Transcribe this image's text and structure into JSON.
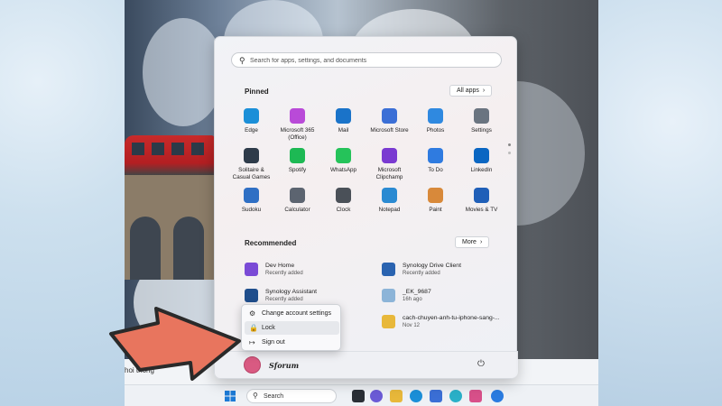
{
  "search": {
    "placeholder": "Search for apps, settings, and documents"
  },
  "pinned": {
    "title": "Pinned",
    "all_apps_label": "All apps",
    "apps": [
      {
        "label": "Edge",
        "icon": "edge-icon",
        "color": "#1b8fd8"
      },
      {
        "label": "Microsoft 365\n(Office)",
        "icon": "office-icon",
        "color": "#b94ad8"
      },
      {
        "label": "Mail",
        "icon": "mail-icon",
        "color": "#1a73c9"
      },
      {
        "label": "Microsoft Store",
        "icon": "store-icon",
        "color": "#3b6fd6"
      },
      {
        "label": "Photos",
        "icon": "photos-icon",
        "color": "#2f89e0"
      },
      {
        "label": "Settings",
        "icon": "settings-icon",
        "color": "#6a7480"
      },
      {
        "label": "Solitaire &\nCasual Games",
        "icon": "solitaire-icon",
        "color": "#2e3b4a"
      },
      {
        "label": "Spotify",
        "icon": "spotify-icon",
        "color": "#1db954"
      },
      {
        "label": "WhatsApp",
        "icon": "whatsapp-icon",
        "color": "#25c35a"
      },
      {
        "label": "Microsoft\nClipchamp",
        "icon": "clipchamp-icon",
        "color": "#7a3ad1"
      },
      {
        "label": "To Do",
        "icon": "todo-icon",
        "color": "#2f7be0"
      },
      {
        "label": "LinkedIn",
        "icon": "linkedin-icon",
        "color": "#0a66c2"
      },
      {
        "label": "Sudoku",
        "icon": "sudoku-icon",
        "color": "#2f6fc4"
      },
      {
        "label": "Calculator",
        "icon": "calculator-icon",
        "color": "#5c6470"
      },
      {
        "label": "Clock",
        "icon": "clock-icon",
        "color": "#4a5058"
      },
      {
        "label": "Notepad",
        "icon": "notepad-icon",
        "color": "#2a8ad2"
      },
      {
        "label": "Paint",
        "icon": "paint-icon",
        "color": "#d8893a"
      },
      {
        "label": "Movies & TV",
        "icon": "movies-icon",
        "color": "#1f5fb8"
      }
    ]
  },
  "recommended": {
    "title": "Recommended",
    "more_label": "More",
    "items": [
      {
        "name": "Dev Home",
        "sub": "Recently added",
        "icon": "dev-home-icon",
        "color": "#7a4ad6"
      },
      {
        "name": "Synology Drive Client",
        "sub": "Recently added",
        "icon": "synology-drive-icon",
        "color": "#2a63b0"
      },
      {
        "name": "Synology Assistant",
        "sub": "Recently added",
        "icon": "synology-assistant-icon",
        "color": "#1f4e8c"
      },
      {
        "name": "_EK_9687",
        "sub": "16h ago",
        "icon": "image-file-icon",
        "color": "#8cb4d8"
      },
      {
        "name": "cach-chuyen-anh-tu-iphone-sang-...",
        "sub": "Nov 12",
        "icon": "folder-icon",
        "color": "#e8b83a"
      }
    ]
  },
  "context_menu": {
    "items": [
      {
        "label": "Change account settings",
        "icon": "account-settings-icon"
      },
      {
        "label": "Lock",
        "icon": "lock-icon"
      },
      {
        "label": "Sign out",
        "icon": "sign-out-icon"
      }
    ]
  },
  "user": {
    "name": "Sforum"
  },
  "taskbar": {
    "search_label": "Search",
    "strip_text": "hoi thong"
  },
  "colors": {
    "arrow": "#e8755e",
    "avatar": "#d95a82"
  }
}
